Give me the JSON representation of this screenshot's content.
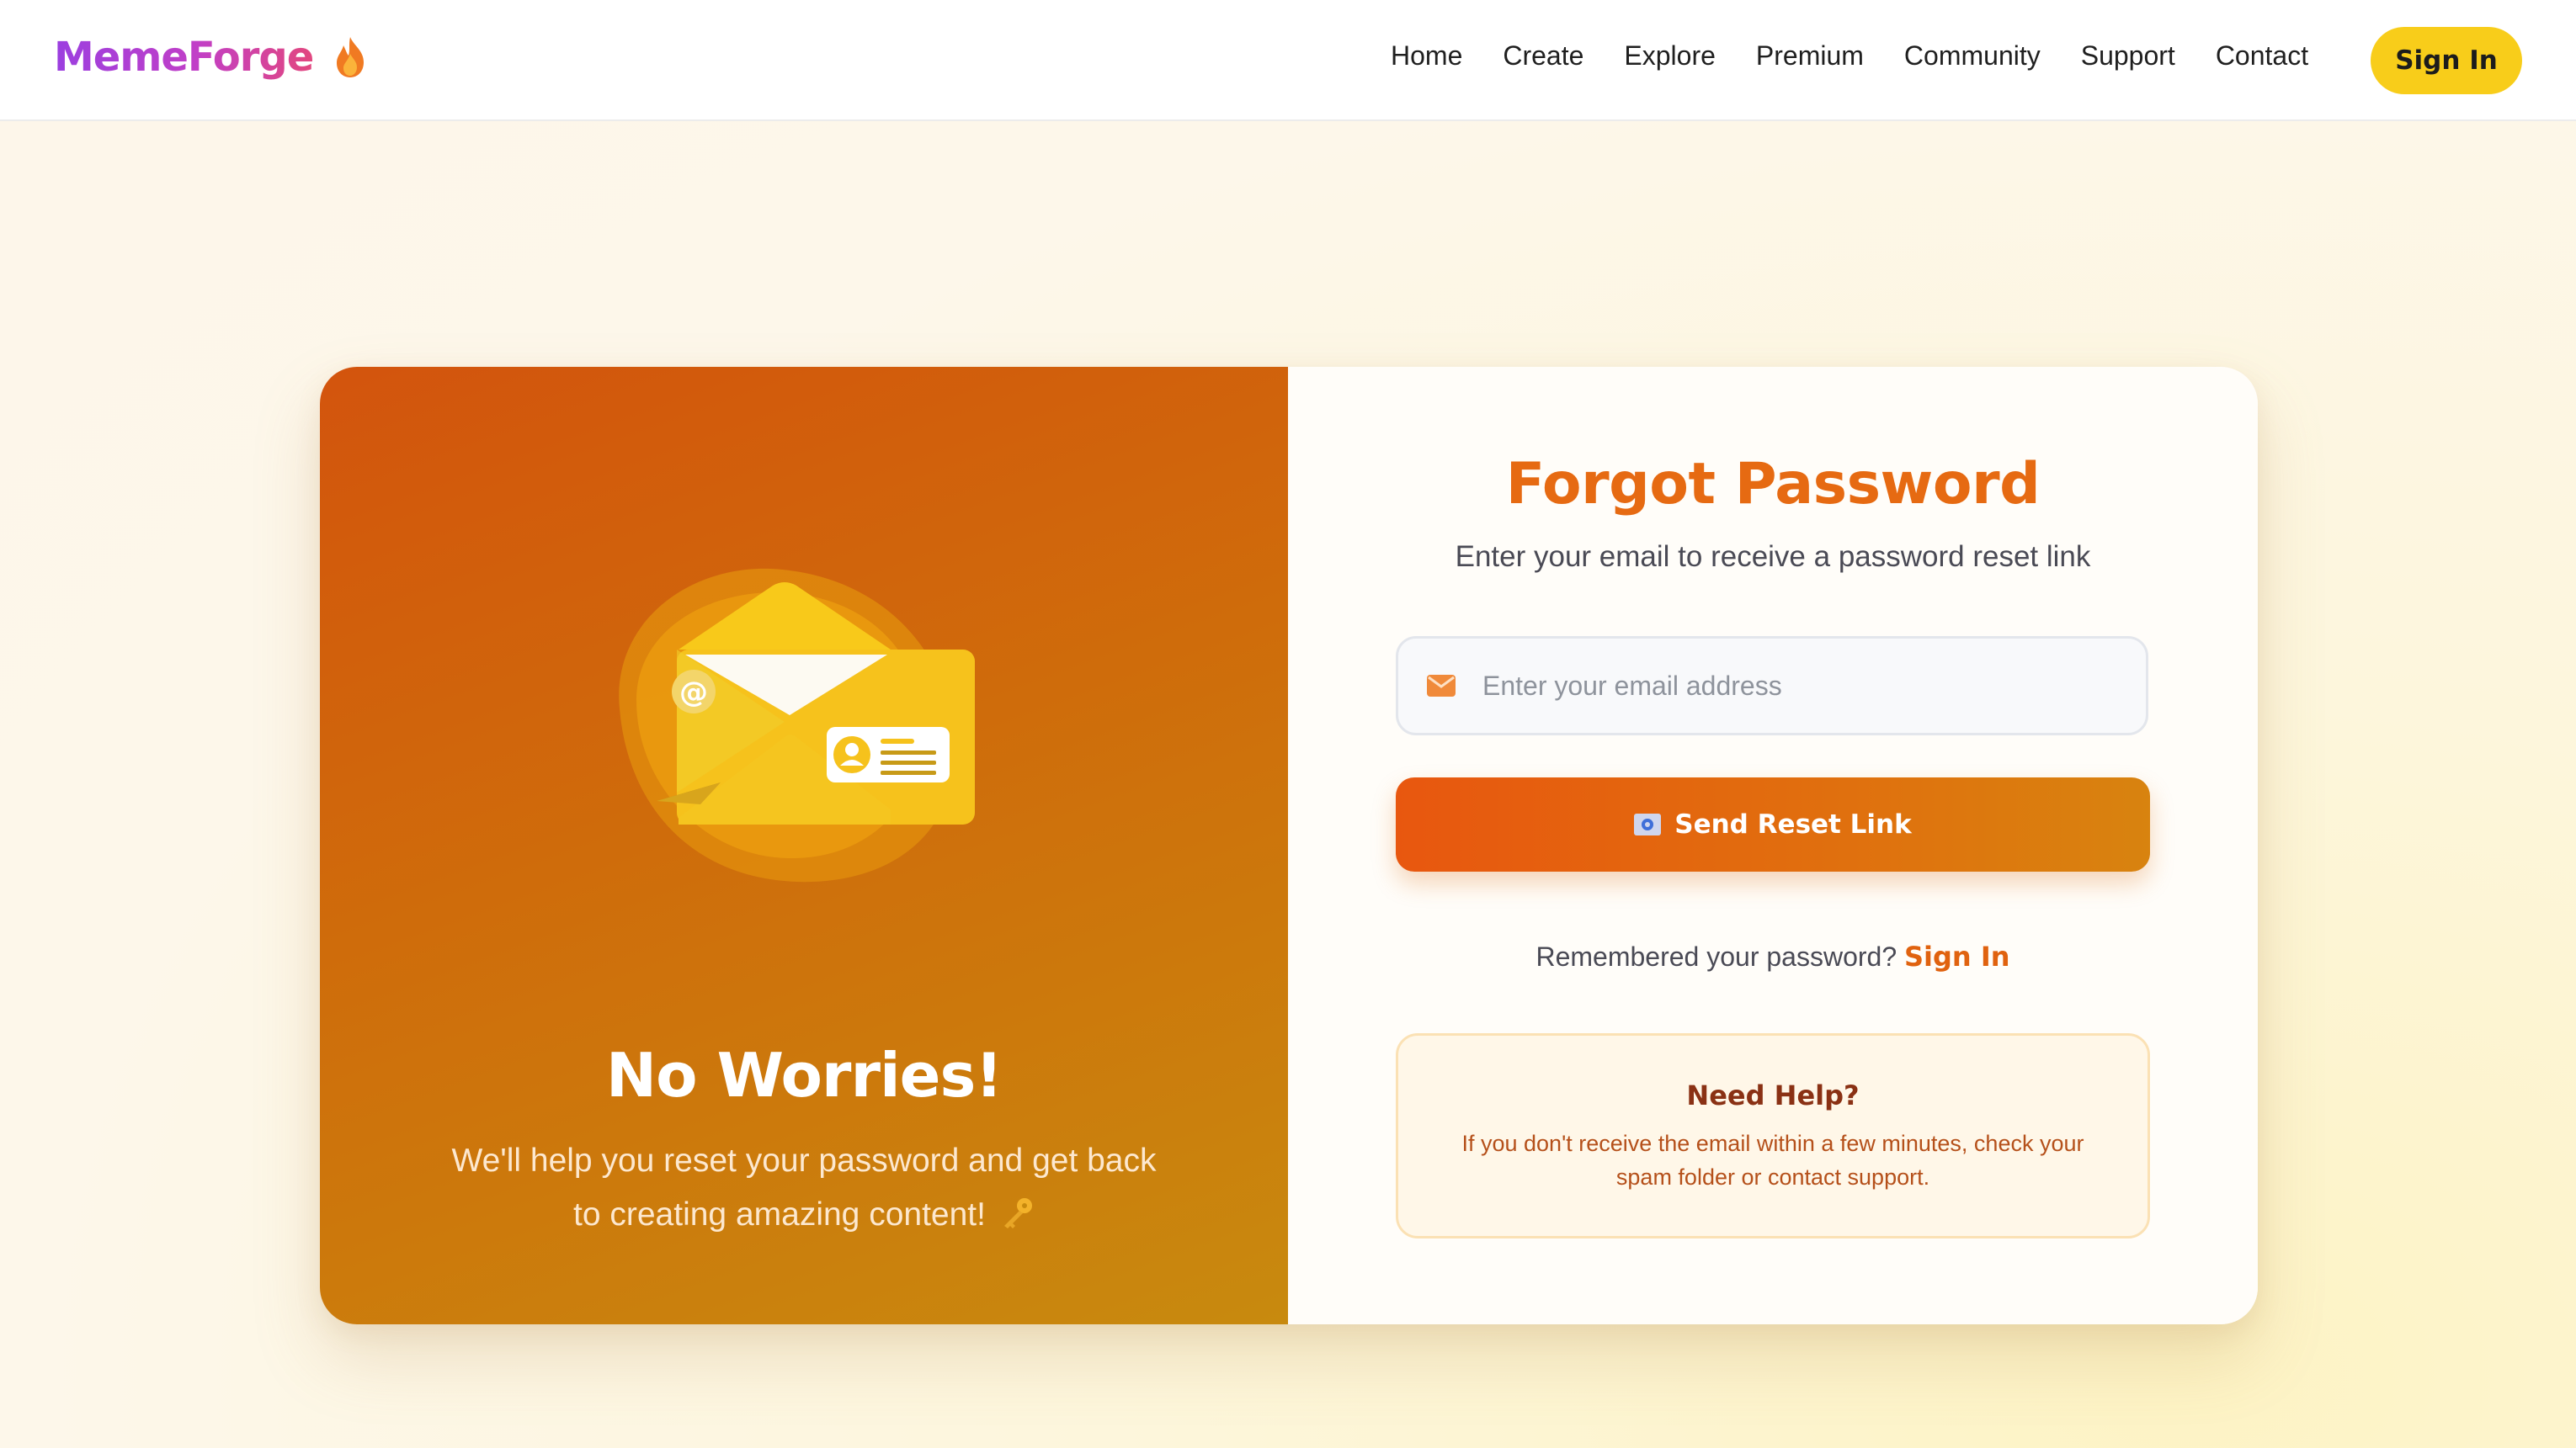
{
  "nav": {
    "brand": "MemeForge",
    "brand_icon": "flame-icon",
    "links": [
      "Home",
      "Create",
      "Explore",
      "Premium",
      "Community",
      "Support",
      "Contact"
    ],
    "signin_label": "Sign In"
  },
  "left": {
    "illustration": "envelope-icon",
    "title": "No Worries!",
    "text": "We'll help you reset your password and get back to creating amazing content!",
    "text_icon": "key-icon"
  },
  "form": {
    "title": "Forgot Password",
    "subtitle": "Enter your email to receive a password reset link",
    "email_placeholder": "Enter your email address",
    "email_value": "",
    "email_icon": "mail-icon",
    "send_label": "Send Reset Link",
    "send_icon": "envelope-icon",
    "remember_text": "Remembered your password?",
    "remember_link": "Sign In"
  },
  "help": {
    "title": "Need Help?",
    "text": "If you don't receive the email within a few minutes, check your spam folder or contact support."
  },
  "colors": {
    "brand_gradient_start": "#9b3fe0",
    "brand_gradient_end": "#e2477f",
    "accent_orange": "#e66a12",
    "signin_yellow": "#f8cd1a",
    "panel_gradient_start": "#d3540d",
    "panel_gradient_end": "#c88a0e"
  }
}
